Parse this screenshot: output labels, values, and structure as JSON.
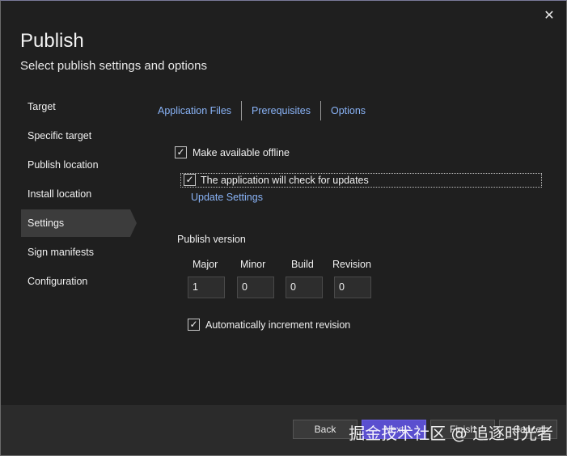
{
  "dialog": {
    "title": "Publish",
    "subtitle": "Select publish settings and options",
    "close_glyph": "✕"
  },
  "sidebar": {
    "items": [
      {
        "label": "Target"
      },
      {
        "label": "Specific target"
      },
      {
        "label": "Publish location"
      },
      {
        "label": "Install location"
      },
      {
        "label": "Settings",
        "active": true
      },
      {
        "label": "Sign manifests"
      },
      {
        "label": "Configuration"
      }
    ]
  },
  "tabs": [
    "Application Files",
    "Prerequisites",
    "Options"
  ],
  "settings": {
    "offline_label": "Make available offline",
    "offline_checked": true,
    "updates_label": "The application will check for updates",
    "updates_checked": true,
    "update_settings_link": "Update Settings",
    "publish_version_label": "Publish version",
    "version": {
      "major_label": "Major",
      "major": "1",
      "minor_label": "Minor",
      "minor": "0",
      "build_label": "Build",
      "build": "0",
      "revision_label": "Revision",
      "revision": "0"
    },
    "auto_increment_label": "Automatically increment revision",
    "auto_increment_checked": true
  },
  "footer": {
    "back_label": "Back",
    "next_label": "Next",
    "finish_label": "Finish",
    "cancel_label": "Cancel"
  },
  "watermark": "掘金技术社区 @ 追逐时光者"
}
